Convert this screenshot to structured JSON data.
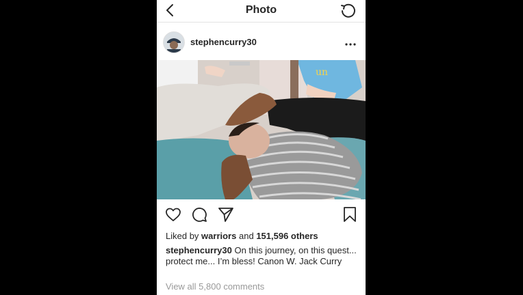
{
  "colors": {
    "accent_text": "#262626",
    "muted": "#999999",
    "background": "#000000",
    "card": "#ffffff"
  },
  "nav": {
    "title": "Photo",
    "back_icon": "chevron-left-icon",
    "refresh_icon": "refresh-icon"
  },
  "post": {
    "username": "stephencurry30",
    "more_icon": "more-dots-icon",
    "photo_alt": "photo of newborn baby wrapped in striped blanket"
  },
  "actions": [
    "heart-icon",
    "comment-icon",
    "share-icon",
    "bookmark-icon"
  ],
  "likes": {
    "prefix": "Liked by",
    "user": "warriors",
    "middle": "and",
    "count": "151,596 others"
  },
  "caption": {
    "username": "stephencurry30",
    "text": "On this journey, on this quest... protect me... I’m bless!  Canon W. Jack Curry"
  },
  "comments": {
    "link": "View all 5,800 comments"
  }
}
